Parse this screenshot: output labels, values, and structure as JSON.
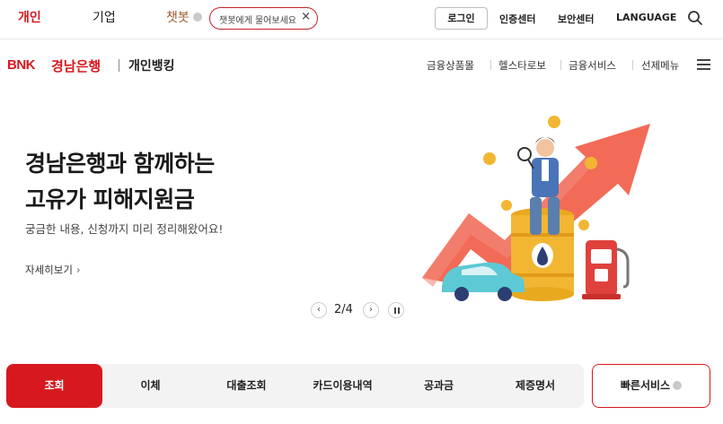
{
  "topbar": {
    "tab_personal": "개인",
    "tab_corporate": "기업",
    "chatbot_label": "챗봇",
    "chatbot_placeholder": "챗봇에게 물어보세요",
    "chatbot_close": "×",
    "login": "로그인",
    "cert_center": "인증센터",
    "security_center": "보안센터",
    "language": "LANGUAGE",
    "accent_color": "#d7191f"
  },
  "brand": {
    "logo_bnk": "BNK",
    "logo_name": "경남은행",
    "sub_title": "개인뱅킹"
  },
  "gnb": {
    "items": [
      "금융상품몰",
      "헬스타로보",
      "금융서비스",
      "선제메뉴"
    ]
  },
  "hero": {
    "title_line1": "경남은행과 함께하는",
    "title_line2": "고유가 피해지원금",
    "subtitle": "궁금한 내용, 신청까지 미리 정리해왔어요!",
    "more_label": "자세히보기",
    "more_arrow": "›",
    "pager": {
      "current": "2/4",
      "prev": "‹",
      "next": "›"
    }
  },
  "quick_menu": {
    "items": [
      "조회",
      "이체",
      "대출조회",
      "카드이용내역",
      "공과금",
      "제증명서"
    ],
    "active_index": 0,
    "fast_service": "빠른서비스"
  }
}
